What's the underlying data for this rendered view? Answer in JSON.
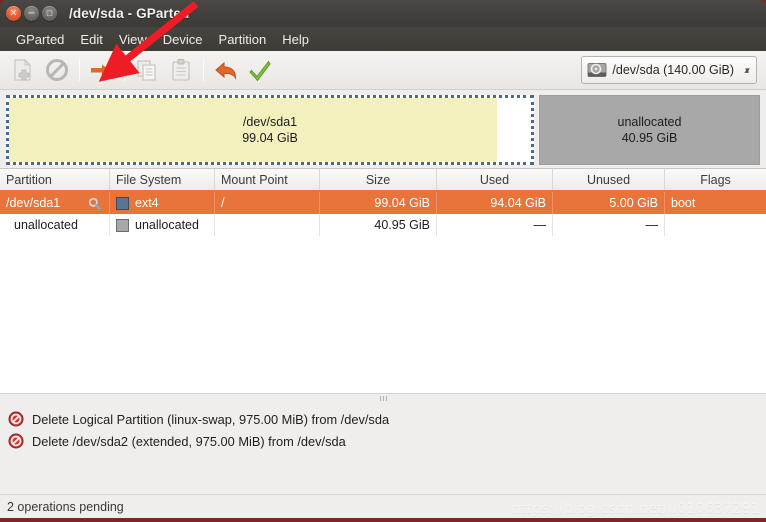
{
  "window": {
    "title": "/dev/sda - GParted",
    "controls": [
      {
        "name": "close",
        "glyph": "✕"
      },
      {
        "name": "minimize",
        "glyph": "−"
      },
      {
        "name": "maximize",
        "glyph": "□"
      }
    ]
  },
  "menubar": {
    "items": [
      "GParted",
      "Edit",
      "View",
      "Device",
      "Partition",
      "Help"
    ]
  },
  "toolbar": {
    "buttons": [
      {
        "name": "new-partition",
        "icon": "new-document-icon",
        "enabled": false
      },
      {
        "name": "delete-partition",
        "icon": "delete-prohibited-icon",
        "enabled": false
      },
      {
        "name": "resize-move-partition",
        "icon": "resize-move-arrow-icon",
        "enabled": true
      },
      {
        "name": "copy-partition",
        "icon": "copy-icon",
        "enabled": false
      },
      {
        "name": "paste-partition",
        "icon": "paste-clipboard-icon",
        "enabled": false
      },
      {
        "name": "undo-operation",
        "icon": "undo-arrow-icon",
        "enabled": true
      },
      {
        "name": "apply-operations",
        "icon": "apply-checkmark-icon",
        "enabled": true
      }
    ]
  },
  "device_selector": {
    "icon": "hard-disk-icon",
    "label": "/dev/sda  (140.00 GiB)",
    "spinner_up": "▴",
    "spinner_down": "▾"
  },
  "graphic": {
    "partitions": [
      {
        "name": "/dev/sda1",
        "size": "99.04 GiB",
        "selected": true,
        "color": "#f2f0bd",
        "used_percent": 93.4
      },
      {
        "name": "unallocated",
        "size": "40.95 GiB",
        "selected": false,
        "color": "#a8a8a8"
      }
    ]
  },
  "table": {
    "headers": [
      "Partition",
      "File System",
      "Mount Point",
      "Size",
      "Used",
      "Unused",
      "Flags"
    ],
    "rows": [
      {
        "partition": "/dev/sda1",
        "has_magnifier": true,
        "fs_color": "#5a7591",
        "filesystem": "ext4",
        "mount_point": "/",
        "size": "99.04 GiB",
        "used": "94.04 GiB",
        "unused": "5.00 GiB",
        "flags": "boot",
        "selected": true
      },
      {
        "partition": "unallocated",
        "has_magnifier": false,
        "fs_color": "#a8a8a8",
        "filesystem": "unallocated",
        "mount_point": "",
        "size": "40.95 GiB",
        "used": "—",
        "unused": "—",
        "flags": "",
        "selected": false
      }
    ]
  },
  "operations": {
    "items": [
      {
        "icon": "delete-prohibited-icon",
        "text": "Delete Logical Partition (linux-swap, 975.00 MiB) from /dev/sda"
      },
      {
        "icon": "delete-prohibited-icon",
        "text": "Delete /dev/sda2 (extended, 975.00 MiB) from /dev/sda"
      }
    ]
  },
  "statusbar": {
    "text": "2 operations pending"
  },
  "watermark": {
    "text": "https://blog.csdn.net/u010637291"
  },
  "colors": {
    "accent_orange": "#e8743c",
    "titlebar": "#413e3a",
    "window_border": "#7d2724",
    "partition_yellow": "#f2f0bd",
    "unallocated_grey": "#a8a8a8",
    "annotation_red": "#ee1c24"
  }
}
